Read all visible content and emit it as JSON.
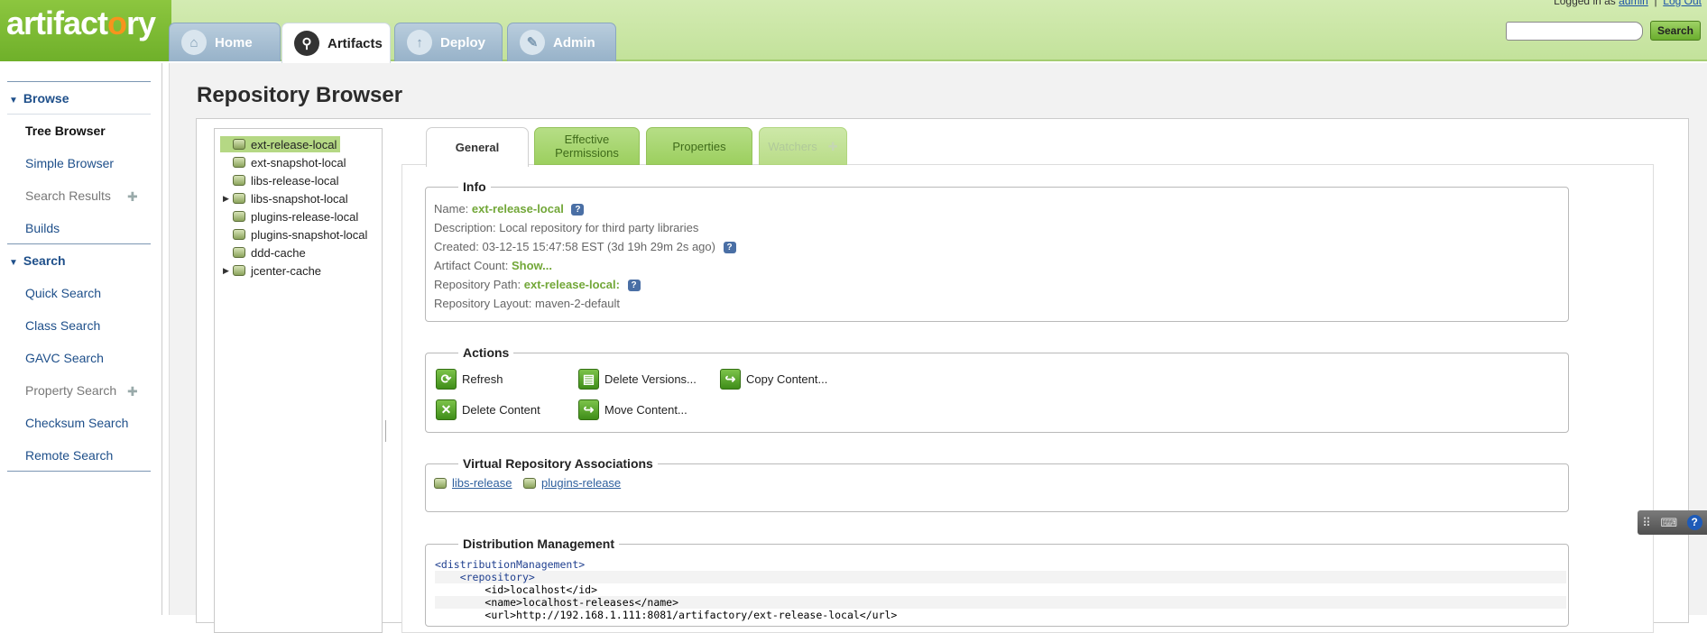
{
  "header": {
    "logo": "artifactory",
    "tabs": [
      {
        "label": "Home",
        "icon": "home-icon"
      },
      {
        "label": "Artifacts",
        "icon": "search-icon"
      },
      {
        "label": "Deploy",
        "icon": "upload-icon"
      },
      {
        "label": "Admin",
        "icon": "wrench-icon"
      }
    ],
    "login": {
      "prefix": "Logged in as",
      "user": "admin",
      "separator": "|",
      "logout": "Log Out"
    },
    "search": {
      "placeholder": "",
      "button": "Search"
    }
  },
  "sidebar": {
    "browse_heading": "Browse",
    "browse_items": [
      "Tree Browser",
      "Simple Browser",
      "Search Results",
      "Builds"
    ],
    "search_heading": "Search",
    "search_items": [
      "Quick Search",
      "Class Search",
      "GAVC Search",
      "Property Search",
      "Checksum Search",
      "Remote Search"
    ]
  },
  "main": {
    "title": "Repository Browser",
    "tree": [
      {
        "label": "ext-release-local",
        "selected": true,
        "expandable": false
      },
      {
        "label": "ext-snapshot-local",
        "expandable": false
      },
      {
        "label": "libs-release-local",
        "expandable": false
      },
      {
        "label": "libs-snapshot-local",
        "expandable": true
      },
      {
        "label": "plugins-release-local",
        "expandable": false
      },
      {
        "label": "plugins-snapshot-local",
        "expandable": false
      },
      {
        "label": "ddd-cache",
        "expandable": false
      },
      {
        "label": "jcenter-cache",
        "expandable": true
      }
    ],
    "tabs": {
      "general": "General",
      "effective_line1": "Effective",
      "effective_line2": "Permissions",
      "properties": "Properties",
      "watchers": "Watchers"
    },
    "info": {
      "legend": "Info",
      "name_label": "Name:",
      "name_value": "ext-release-local",
      "description": "Description: Local repository for third party libraries",
      "created": "Created: 03-12-15 15:47:58 EST (3d 19h 29m 2s ago)",
      "artifact_count_label": "Artifact Count:",
      "artifact_count_link": "Show...",
      "repo_path_label": "Repository Path:",
      "repo_path_value": "ext-release-local:",
      "layout": "Repository Layout: maven-2-default"
    },
    "actions": {
      "legend": "Actions",
      "refresh": "Refresh",
      "delete_versions": "Delete Versions...",
      "copy_content": "Copy Content...",
      "delete_content": "Delete Content",
      "move_content": "Move Content..."
    },
    "virtual": {
      "legend": "Virtual Repository Associations",
      "repos": [
        "libs-release",
        "plugins-release"
      ]
    },
    "distribution": {
      "legend": "Distribution Management",
      "lines": [
        {
          "indent": "",
          "text": "<distributionManagement>"
        },
        {
          "indent": "    ",
          "text": "<repository>"
        },
        {
          "indent": "        ",
          "text": "<id>localhost</id>"
        },
        {
          "indent": "        ",
          "text": "<name>localhost-releases</name>"
        },
        {
          "indent": "        ",
          "text": "<url>http://192.168.1.111:8081/artifactory/ext-release-local</url>"
        }
      ]
    }
  },
  "colors": {
    "brand_green": "#8cc63f",
    "tab_blue": "#a8c0d4",
    "link_blue": "#1e4f8a"
  }
}
